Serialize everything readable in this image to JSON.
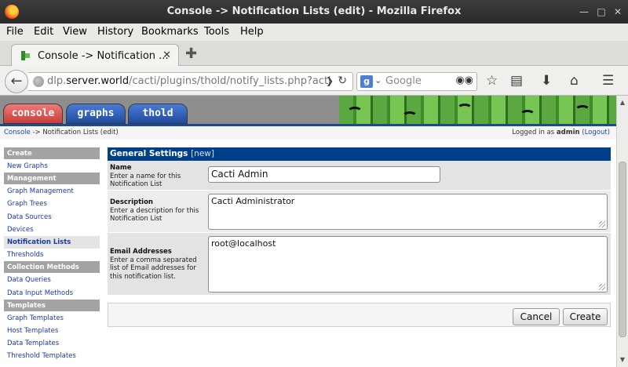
{
  "window": {
    "title": "Console -> Notification Lists (edit) - Mozilla Firefox"
  },
  "menu": {
    "items": [
      "File",
      "Edit",
      "View",
      "History",
      "Bookmarks",
      "Tools",
      "Help"
    ]
  },
  "tab": {
    "label": "Console -> Notification ...",
    "close": "✕",
    "new": "✚"
  },
  "nav": {
    "url_prefix": "dlp.",
    "url_host": "server.world",
    "url_path": "/cacti/plugins/thold/notify_lists.php?action=e",
    "search_placeholder": "Google",
    "search_engine": "g"
  },
  "banner": {
    "tabs": [
      "console",
      "graphs",
      "thold"
    ]
  },
  "breadcrumb": {
    "home": "Console",
    "current": " -> Notification Lists (edit)",
    "login_prefix": "Logged in as ",
    "user": "admin",
    "logout": "(Logout)"
  },
  "sidebar": {
    "sections": [
      {
        "header": "Create",
        "items": [
          "New Graphs"
        ]
      },
      {
        "header": "Management",
        "items": [
          "Graph Management",
          "Graph Trees",
          "Data Sources",
          "Devices",
          "Notification Lists",
          "Thresholds"
        ]
      },
      {
        "header": "Collection Methods",
        "items": [
          "Data Queries",
          "Data Input Methods"
        ]
      },
      {
        "header": "Templates",
        "items": [
          "Graph Templates",
          "Host Templates",
          "Data Templates",
          "Threshold Templates"
        ]
      }
    ],
    "active": "Notification Lists"
  },
  "form": {
    "section_title": "General Settings",
    "section_tag": "[new]",
    "name": {
      "label": "Name",
      "desc": "Enter a name for this Notification List",
      "value": "Cacti Admin"
    },
    "description": {
      "label": "Description",
      "desc": "Enter a description for this Notification List",
      "value": "Cacti Administrator"
    },
    "emails": {
      "label": "Email Addresses",
      "desc": "Enter a comma separated list of Email addresses for this notification list.",
      "value": "root@localhost"
    },
    "cancel_label": "Cancel",
    "create_label": "Create"
  }
}
